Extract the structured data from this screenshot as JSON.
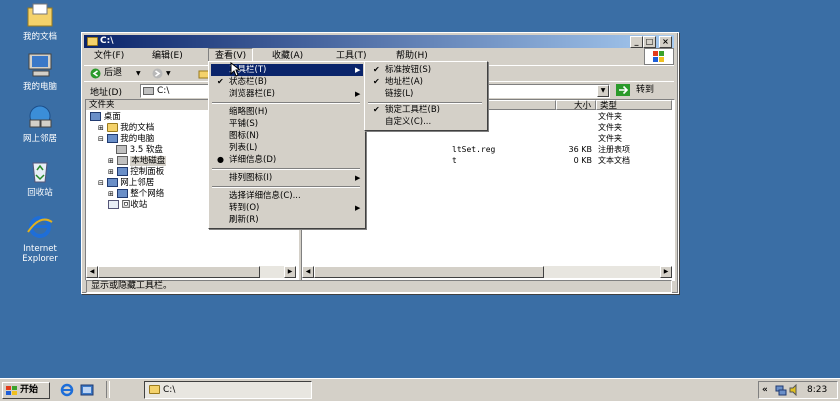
{
  "desktop": {
    "icons": [
      {
        "label": "我的文档",
        "icon": "my-documents-icon"
      },
      {
        "label": "我的电脑",
        "icon": "my-computer-icon"
      },
      {
        "label": "网上邻居",
        "icon": "network-places-icon"
      },
      {
        "label": "回收站",
        "icon": "recycle-bin-icon"
      },
      {
        "label": "Internet\nExplorer",
        "label1": "Internet",
        "label2": "Explorer",
        "icon": "internet-explorer-icon"
      }
    ]
  },
  "window": {
    "title": "C:\\",
    "menubar": [
      "文件(F)",
      "编辑(E)",
      "查看(V)",
      "收藏(A)",
      "工具(T)",
      "帮助(H)"
    ],
    "toolbar": {
      "back_label": "后退"
    },
    "address": {
      "label": "地址(D)",
      "value": "C:\\",
      "go_label": "转到"
    },
    "left_pane": {
      "header": "文件夹",
      "tree": [
        "桌面",
        "我的文档",
        "我的电脑",
        "3.5 软盘",
        "本地磁盘",
        "控制面板",
        "网上邻居",
        "整个网络",
        "回收站"
      ]
    },
    "right_pane": {
      "columns": {
        "size": "大小",
        "type": "类型"
      },
      "rows": [
        {
          "name": "",
          "size": "",
          "type": "文件夹"
        },
        {
          "name": "",
          "size": "",
          "type": "文件夹"
        },
        {
          "name": "",
          "size": "",
          "type": "文件夹"
        },
        {
          "name": "ltSet.reg",
          "size": "36 KB",
          "type": "注册表项"
        },
        {
          "name": "t",
          "size": "0 KB",
          "type": "文本文档"
        }
      ]
    },
    "status": "显示或隐藏工具栏。"
  },
  "view_menu": {
    "items": [
      "工具栏(T)",
      "状态栏(B)",
      "浏览器栏(E)",
      "缩略图(H)",
      "平铺(S)",
      "图标(N)",
      "列表(L)",
      "详细信息(D)",
      "排列图标(I)",
      "选择详细信息(C)...",
      "转到(O)",
      "刷新(R)"
    ]
  },
  "toolbar_submenu": {
    "items": [
      "标准按钮(S)",
      "地址栏(A)",
      "链接(L)",
      "锁定工具栏(B)",
      "自定义(C)..."
    ]
  },
  "taskbar": {
    "start_label": "开始",
    "task_label": "C:\\",
    "clock": "8:23",
    "chevron": "«"
  },
  "colors": {
    "desktop": "#3a6ea5",
    "titlebar": "#0a246a",
    "highlight": "#0a246a"
  }
}
